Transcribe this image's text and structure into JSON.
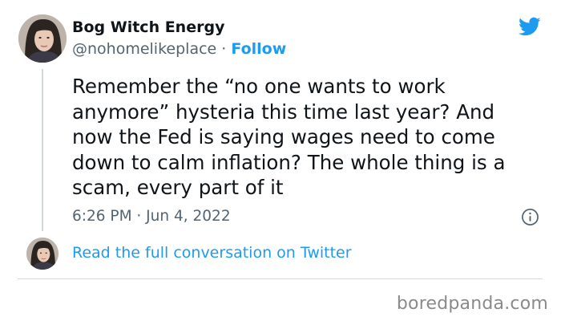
{
  "tweet": {
    "display_name": "Bog Witch Energy",
    "handle": "@nohomelikeplace",
    "separator": " · ",
    "follow_label": "Follow",
    "text": "Remember the “no one wants to work anymore” hysteria this time last year? And now the Fed is saying wages need to come down to calm inflation? The whole thing is a scam, every part of it",
    "timestamp": "6:26 PM · Jun 4, 2022",
    "read_full_label": "Read the full conversation on Twitter"
  },
  "icons": {
    "brand": "twitter-bird-icon",
    "info": "info-icon"
  },
  "watermark": "boredpanda.com",
  "colors": {
    "accent": "#1d9bf0",
    "text": "#0f1419",
    "muted": "#536471",
    "divider": "#cfd9de",
    "watermark": "#8a8a8a"
  }
}
